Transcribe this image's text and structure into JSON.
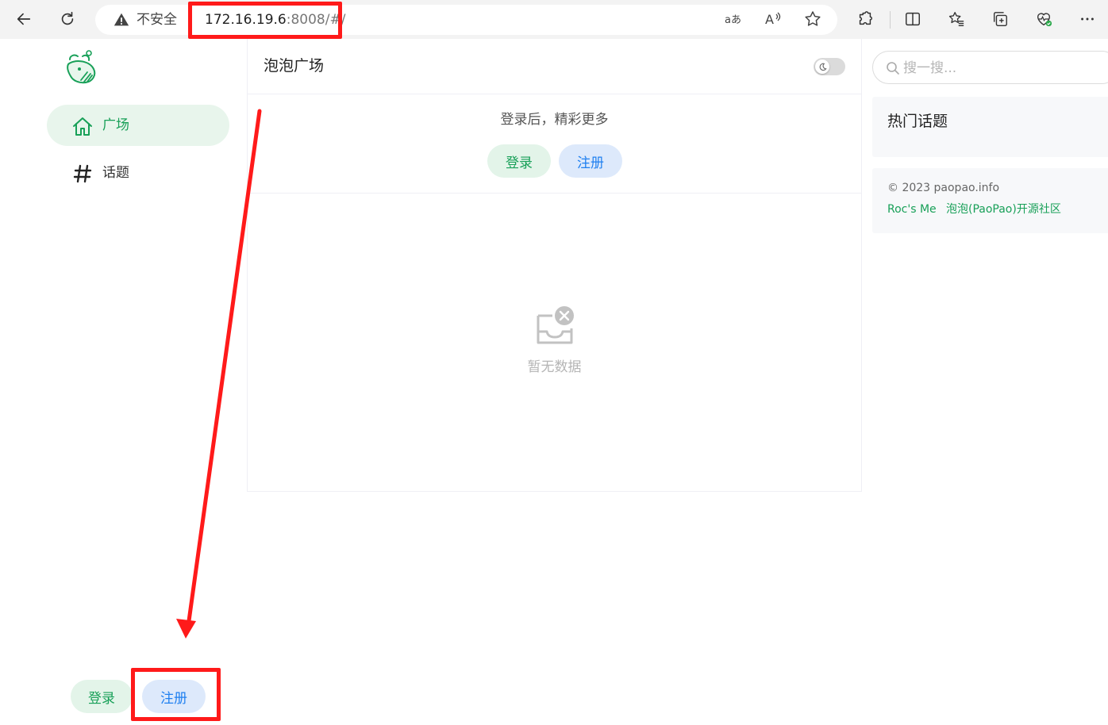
{
  "browser": {
    "security_label": "不安全",
    "url_host": "172.16.19.6",
    "url_rest": ":8008/#/"
  },
  "sidebar": {
    "items": [
      {
        "label": "广场",
        "icon": "home-icon",
        "active": true
      },
      {
        "label": "话题",
        "icon": "hash-icon",
        "active": false
      }
    ],
    "login_label": "登录",
    "register_label": "注册"
  },
  "main": {
    "title": "泡泡广场",
    "login_tip": "登录后，精彩更多",
    "login_label": "登录",
    "register_label": "注册",
    "empty_text": "暂无数据"
  },
  "right": {
    "search_placeholder": "搜一搜...",
    "hot_topics_title": "热门话题",
    "copyright": "© 2023 paopao.info",
    "links": [
      "Roc's Me",
      "泡泡(PaoPao)开源社区"
    ]
  },
  "colors": {
    "brand": "#18a058",
    "info": "#2080f0",
    "annotation": "#ff1a1a"
  }
}
